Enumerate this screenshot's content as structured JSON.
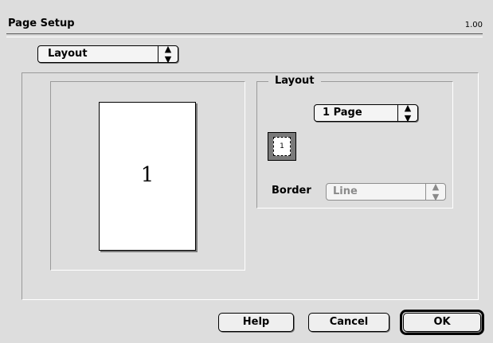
{
  "dialog": {
    "title": "Page Setup",
    "version": "1.00"
  },
  "panel_select": {
    "value": "Layout"
  },
  "preview": {
    "page_number": "1"
  },
  "layout": {
    "legend": "Layout",
    "pages_per_sheet": "1 Page",
    "icon_number": "1",
    "border_label": "Border",
    "border_value": "Line"
  },
  "buttons": {
    "help": "Help",
    "cancel": "Cancel",
    "ok": "OK"
  }
}
